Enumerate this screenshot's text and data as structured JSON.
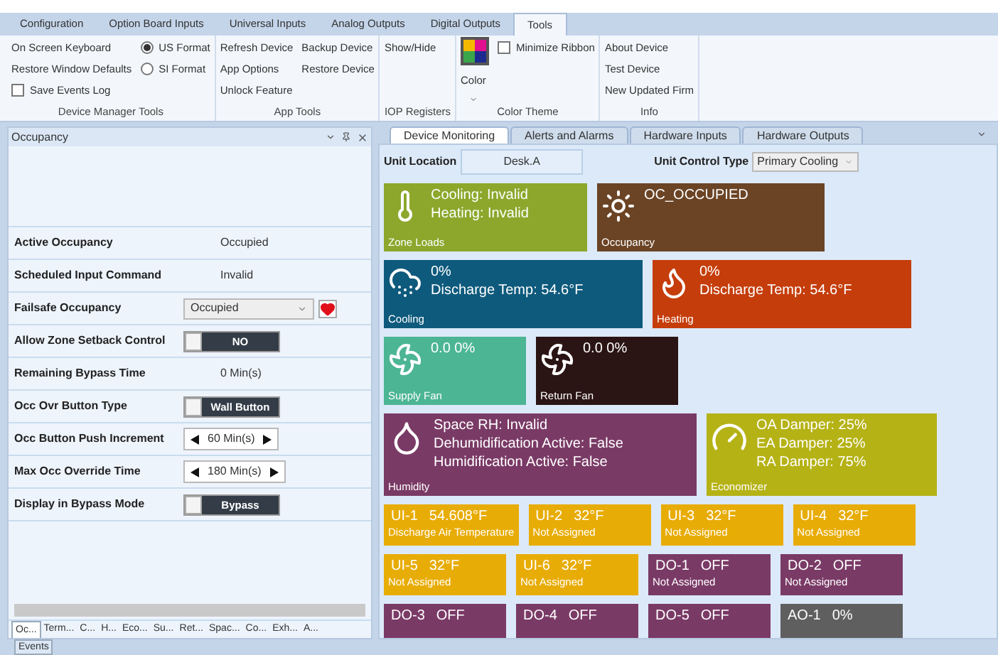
{
  "ribbon": {
    "tabs": [
      {
        "label": "Configuration",
        "selected": false
      },
      {
        "label": "Option Board Inputs",
        "selected": false
      },
      {
        "label": "Universal Inputs",
        "selected": false
      },
      {
        "label": "Analog Outputs",
        "selected": false
      },
      {
        "label": "Digital Outputs",
        "selected": false
      },
      {
        "label": "Tools",
        "selected": true
      }
    ],
    "groups": [
      {
        "title": "Device Manager Tools",
        "columns": [
          [
            {
              "kind": "link",
              "text": "On Screen Keyboard"
            },
            {
              "kind": "link",
              "text": "Restore Window Defaults"
            },
            {
              "kind": "checkbox",
              "text": "Save Events Log",
              "checked": false
            }
          ],
          [
            {
              "kind": "radio",
              "text": "US Format",
              "selected": true
            },
            {
              "kind": "radio",
              "text": "SI Format",
              "selected": false
            }
          ]
        ]
      },
      {
        "title": "App Tools",
        "columns": [
          [
            {
              "kind": "link",
              "text": "Refresh Device"
            },
            {
              "kind": "link",
              "text": "App Options"
            },
            {
              "kind": "link",
              "text": "Unlock Feature"
            }
          ],
          [
            {
              "kind": "link",
              "text": "Backup Device"
            },
            {
              "kind": "link",
              "text": "Restore Device"
            }
          ]
        ]
      },
      {
        "title": "IOP Registers",
        "columns": [
          [
            {
              "kind": "link",
              "text": "Show/Hide"
            }
          ]
        ]
      },
      {
        "title": "Color Theme",
        "columns": [
          [
            {
              "kind": "swatch",
              "text": "Color"
            }
          ],
          [
            {
              "kind": "checkbox",
              "text": "Minimize Ribbon",
              "checked": false
            }
          ]
        ]
      },
      {
        "title": "Info",
        "columns": [
          [
            {
              "kind": "link",
              "text": "About Device"
            },
            {
              "kind": "link",
              "text": "Test Device"
            },
            {
              "kind": "link",
              "text": "New Updated Firm"
            }
          ]
        ]
      }
    ]
  },
  "left_panel": {
    "title": "Occupancy",
    "rows": [
      {
        "kind": "text",
        "label": "Active Occupancy",
        "value": "Occupied"
      },
      {
        "kind": "text",
        "label": "Scheduled Input Command",
        "value": "Invalid"
      },
      {
        "kind": "dropdown",
        "label": "Failsafe Occupancy",
        "value": "Occupied"
      },
      {
        "kind": "toggle",
        "label": "Allow Zone Setback Control",
        "value": "NO",
        "on": false
      },
      {
        "kind": "text",
        "label": "Remaining Bypass Time",
        "value": "0 Min(s)"
      },
      {
        "kind": "toggle",
        "label": "Occ Ovr Button Type",
        "value": "Wall Button",
        "on": false
      },
      {
        "kind": "stepper",
        "label": "Occ Button Push Increment",
        "value": "60 Min(s)"
      },
      {
        "kind": "stepper",
        "label": "Max Occ Override Time",
        "value": "180 Min(s)"
      },
      {
        "kind": "toggle",
        "label": "Display in Bypass Mode",
        "value": "Bypass",
        "on": false
      }
    ],
    "tabs": [
      {
        "label": "Oc...",
        "selected": true
      },
      {
        "label": "Term...",
        "selected": false
      },
      {
        "label": "C...",
        "selected": false
      },
      {
        "label": "H...",
        "selected": false
      },
      {
        "label": "Eco...",
        "selected": false
      },
      {
        "label": "Su...",
        "selected": false
      },
      {
        "label": "Ret...",
        "selected": false
      },
      {
        "label": "Spac...",
        "selected": false
      },
      {
        "label": "Co...",
        "selected": false
      },
      {
        "label": "Exh...",
        "selected": false
      },
      {
        "label": "A...",
        "selected": false
      }
    ]
  },
  "document_tabs": [
    {
      "label": "Device Monitoring",
      "selected": true
    },
    {
      "label": "Alerts and Alarms",
      "selected": false
    },
    {
      "label": "Hardware Inputs",
      "selected": false
    },
    {
      "label": "Hardware Outputs",
      "selected": false
    }
  ],
  "unit_location": {
    "label": "Unit Location",
    "value": "Desk.A"
  },
  "unit_control_type": {
    "label": "Unit Control Type",
    "value": "Primary Cooling"
  },
  "tile_rows": [
    [
      {
        "kind": "zone_loads",
        "color": "#8ca72c",
        "lines": [
          "Cooling: Invalid",
          "Heating: Invalid"
        ],
        "label": "Zone Loads"
      },
      {
        "kind": "occupancy",
        "color": "#6b4425",
        "lines": [
          "OC_OCCUPIED"
        ],
        "label": "Occupancy"
      }
    ],
    [
      {
        "kind": "cooling",
        "color": "#0e5a7c",
        "lines": [
          "0%",
          "Discharge Temp: 54.6°F"
        ],
        "label": "Cooling"
      },
      {
        "kind": "heating",
        "color": "#c53d0b",
        "lines": [
          "0%",
          "Discharge Temp: 54.6°F"
        ],
        "label": "Heating"
      }
    ],
    [
      {
        "kind": "fan",
        "color": "#4cb594",
        "lines": [
          "0.0 0%"
        ],
        "label": "Supply Fan"
      },
      {
        "kind": "fan",
        "color": "#2b1414",
        "lines": [
          "0.0 0%"
        ],
        "label": "Return Fan"
      }
    ],
    [
      {
        "kind": "humidity",
        "color": "#7a3a66",
        "lines": [
          "Space RH: Invalid",
          "Dehumidification Active: False",
          "Humidification Active: False"
        ],
        "label": "Humidity"
      },
      {
        "kind": "economizer",
        "color": "#b5b216",
        "lines": [
          "OA Damper: 25%",
          "EA Damper: 25%",
          "RA Damper: 75%"
        ],
        "label": "Economizer"
      }
    ],
    [
      {
        "kind": "io",
        "color": "#e8ac06",
        "name": "UI-1",
        "value": "54.608°F",
        "label": "Discharge Air Temperature"
      },
      {
        "kind": "io",
        "color": "#e8ac06",
        "name": "UI-2",
        "value": "32°F",
        "label": "Not Assigned"
      },
      {
        "kind": "io",
        "color": "#e8ac06",
        "name": "UI-3",
        "value": "32°F",
        "label": "Not Assigned"
      },
      {
        "kind": "io",
        "color": "#e8ac06",
        "name": "UI-4",
        "value": "32°F",
        "label": "Not Assigned"
      }
    ],
    [
      {
        "kind": "io",
        "color": "#e8ac06",
        "name": "UI-5",
        "value": "32°F",
        "label": "Not Assigned"
      },
      {
        "kind": "io",
        "color": "#e8ac06",
        "name": "UI-6",
        "value": "32°F",
        "label": "Not Assigned"
      },
      {
        "kind": "io",
        "color": "#7a3a66",
        "name": "DO-1",
        "value": "OFF",
        "label": "Not Assigned"
      },
      {
        "kind": "io",
        "color": "#7a3a66",
        "name": "DO-2",
        "value": "OFF",
        "label": "Not Assigned"
      }
    ],
    [
      {
        "kind": "io",
        "color": "#7a3a66",
        "name": "DO-3",
        "value": "OFF"
      },
      {
        "kind": "io",
        "color": "#7a3a66",
        "name": "DO-4",
        "value": "OFF"
      },
      {
        "kind": "io",
        "color": "#7a3a66",
        "name": "DO-5",
        "value": "OFF"
      },
      {
        "kind": "io",
        "color": "#5f5f5f",
        "name": "AO-1",
        "value": "0%"
      }
    ]
  ],
  "bottom_tab": {
    "label": "Events"
  }
}
